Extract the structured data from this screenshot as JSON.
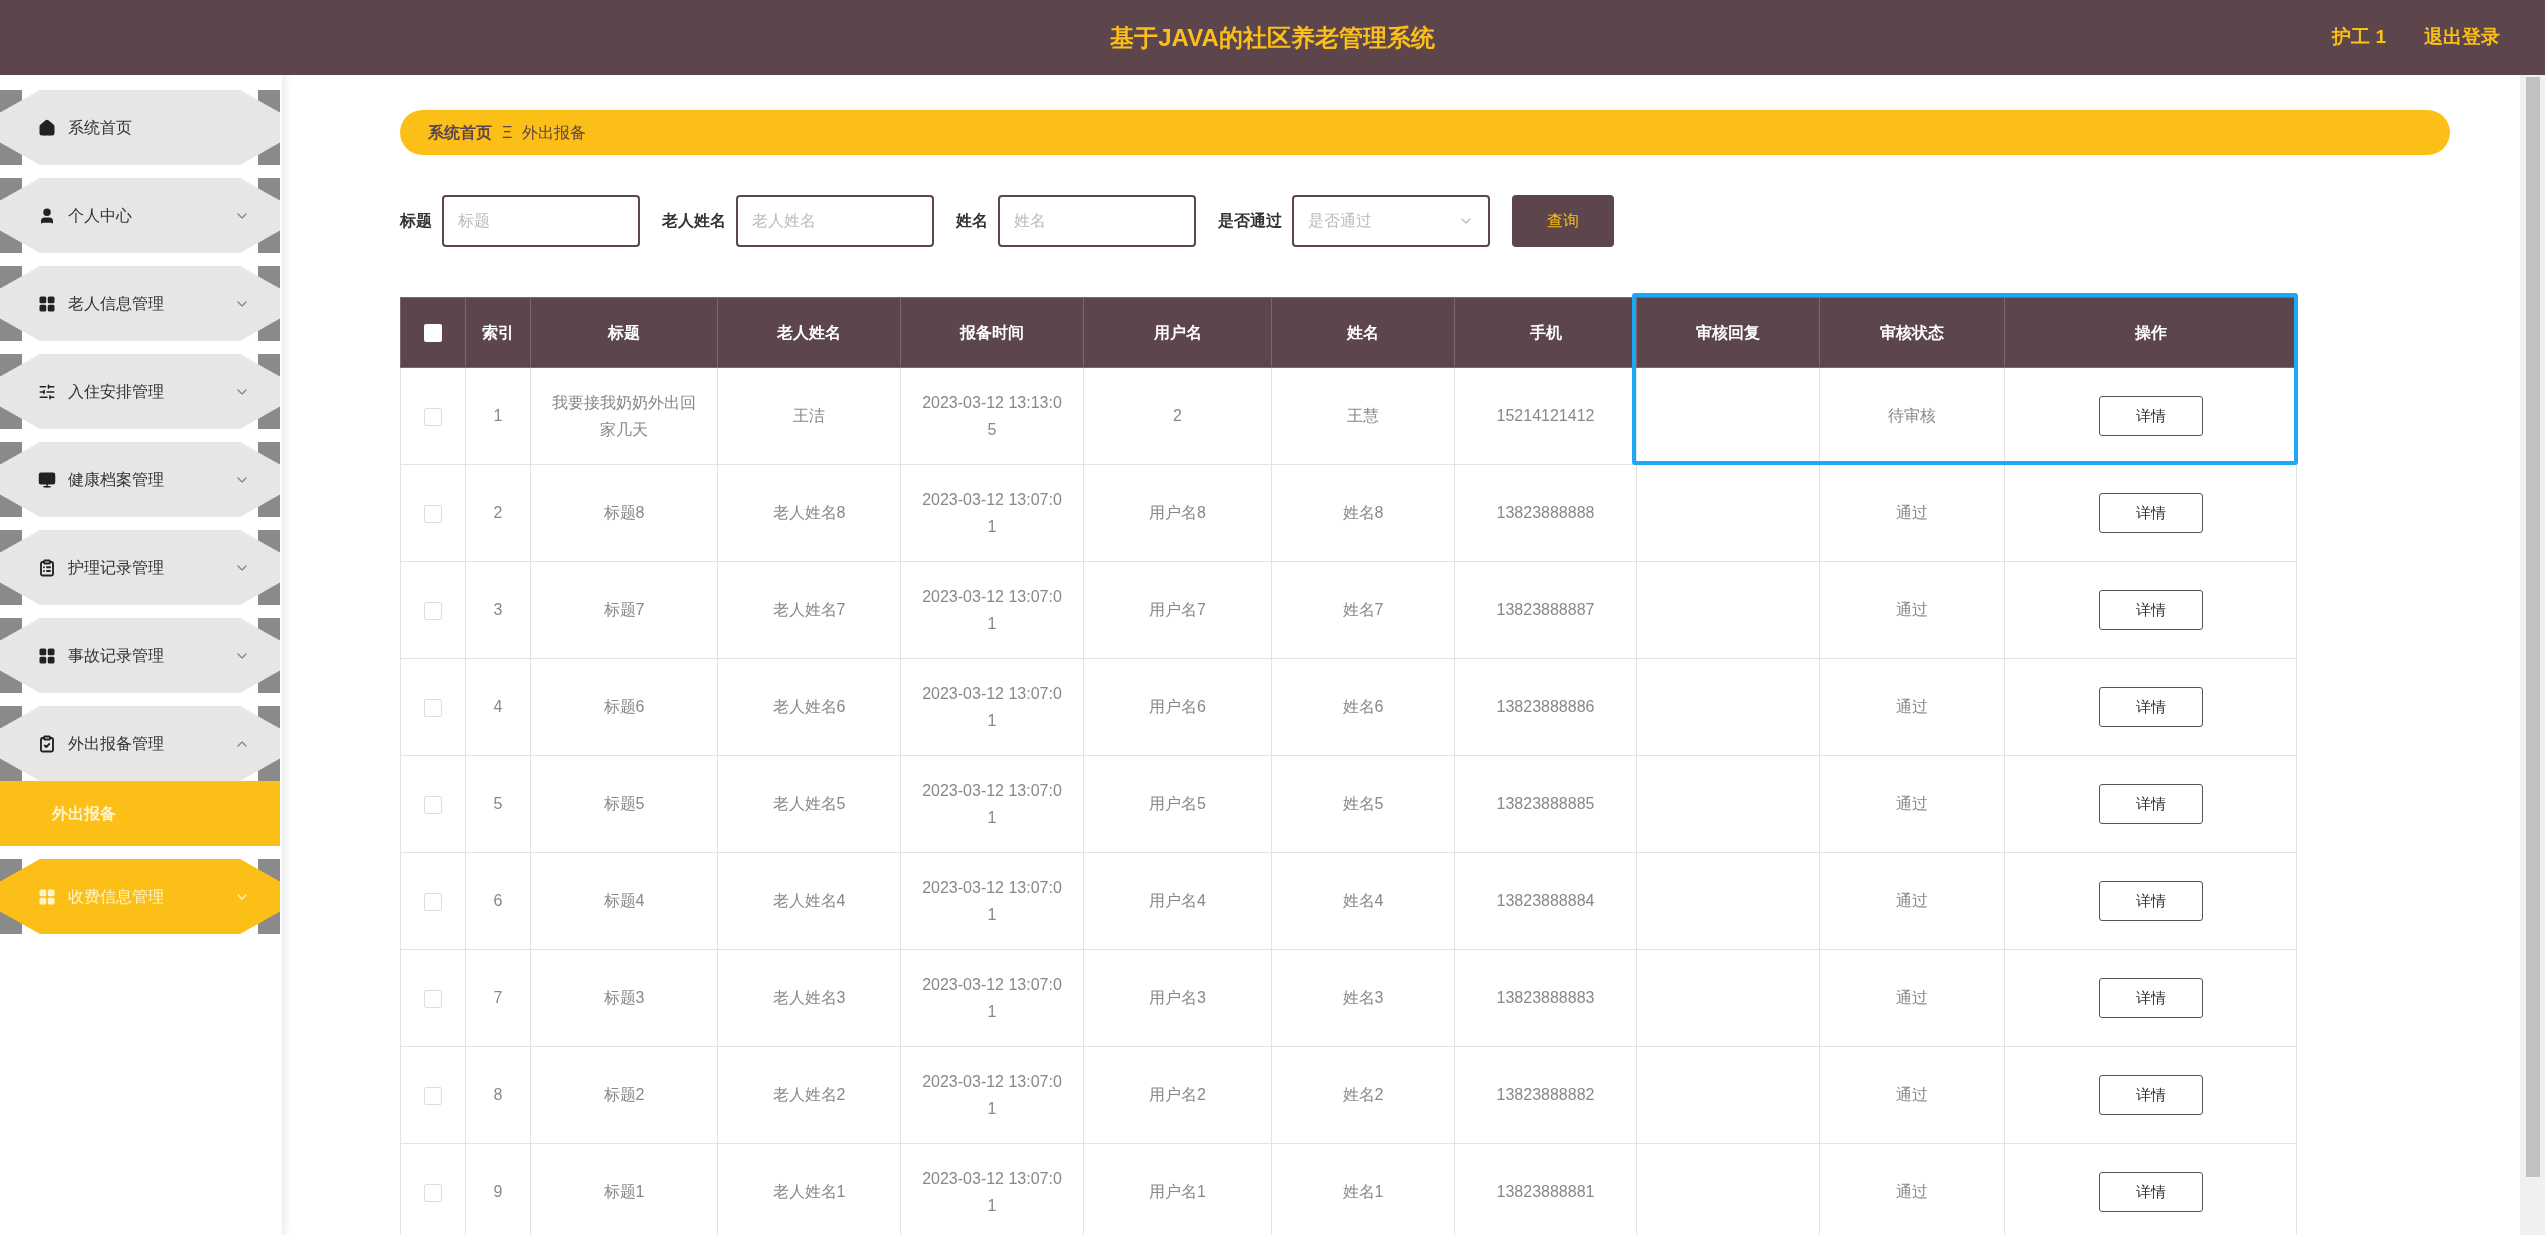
{
  "header": {
    "title": "基于JAVA的社区养老管理系统",
    "user": "护工 1",
    "logout": "退出登录"
  },
  "sidebar": {
    "items": [
      {
        "label": "系统首页",
        "selected": false
      },
      {
        "label": "个人中心",
        "selected": false,
        "expanded": false
      },
      {
        "label": "老人信息管理",
        "selected": false,
        "expanded": false
      },
      {
        "label": "入住安排管理",
        "selected": false,
        "expanded": false
      },
      {
        "label": "健康档案管理",
        "selected": false,
        "expanded": false
      },
      {
        "label": "护理记录管理",
        "selected": false,
        "expanded": false
      },
      {
        "label": "事故记录管理",
        "selected": false,
        "expanded": false
      },
      {
        "label": "外出报备管理",
        "selected": false,
        "expanded": true,
        "children": [
          {
            "label": "外出报备",
            "selected": true
          }
        ]
      },
      {
        "label": "收费信息管理",
        "selected": true,
        "expanded": false
      }
    ]
  },
  "breadcrumb": {
    "home": "系统首页",
    "separator": "Ξ",
    "current": "外出报备"
  },
  "search": {
    "fields": [
      {
        "kind": "input",
        "label": "标题",
        "placeholder": "标题"
      },
      {
        "kind": "input",
        "label": "老人姓名",
        "placeholder": "老人姓名"
      },
      {
        "kind": "input",
        "label": "姓名",
        "placeholder": "姓名"
      },
      {
        "kind": "select",
        "label": "是否通过",
        "placeholder": "是否通过"
      }
    ],
    "button": "查询"
  },
  "table": {
    "header_checkbox": {
      "checked": false
    },
    "columns": [
      "索引",
      "标题",
      "老人姓名",
      "报备时间",
      "用户名",
      "姓名",
      "手机",
      "审核回复",
      "审核状态",
      "操作"
    ],
    "rows": [
      {
        "checked": false,
        "index": "1",
        "title": "我要接我奶奶外出回家几天",
        "elder": "王洁",
        "time": "2023-03-12 13:13:05",
        "username": "2",
        "name": "王慧",
        "phone": "15214121412",
        "status": "待审核",
        "action": "详情"
      },
      {
        "checked": false,
        "index": "2",
        "title": "标题8",
        "elder": "老人姓名8",
        "time": "2023-03-12 13:07:01",
        "username": "用户名8",
        "name": "姓名8",
        "phone": "13823888888",
        "status": "通过",
        "action": "详情"
      },
      {
        "checked": false,
        "index": "3",
        "title": "标题7",
        "elder": "老人姓名7",
        "time": "2023-03-12 13:07:01",
        "username": "用户名7",
        "name": "姓名7",
        "phone": "13823888887",
        "status": "通过",
        "action": "详情"
      },
      {
        "checked": false,
        "index": "4",
        "title": "标题6",
        "elder": "老人姓名6",
        "time": "2023-03-12 13:07:01",
        "username": "用户名6",
        "name": "姓名6",
        "phone": "13823888886",
        "status": "通过",
        "action": "详情"
      },
      {
        "checked": false,
        "index": "5",
        "title": "标题5",
        "elder": "老人姓名5",
        "time": "2023-03-12 13:07:01",
        "username": "用户名5",
        "name": "姓名5",
        "phone": "13823888885",
        "status": "通过",
        "action": "详情"
      },
      {
        "checked": false,
        "index": "6",
        "title": "标题4",
        "elder": "老人姓名4",
        "time": "2023-03-12 13:07:01",
        "username": "用户名4",
        "name": "姓名4",
        "phone": "13823888884",
        "status": "通过",
        "action": "详情"
      },
      {
        "checked": false,
        "index": "7",
        "title": "标题3",
        "elder": "老人姓名3",
        "time": "2023-03-12 13:07:01",
        "username": "用户名3",
        "name": "姓名3",
        "phone": "13823888883",
        "status": "通过",
        "action": "详情"
      },
      {
        "checked": false,
        "index": "8",
        "title": "标题2",
        "elder": "老人姓名2",
        "time": "2023-03-12 13:07:01",
        "username": "用户名2",
        "name": "姓名2",
        "phone": "13823888882",
        "status": "通过",
        "action": "详情"
      },
      {
        "checked": false,
        "index": "9",
        "title": "标题1",
        "elder": "老人姓名1",
        "time": "2023-03-12 13:07:01",
        "username": "用户名1",
        "name": "姓名1",
        "phone": "13823888881",
        "status": "通过",
        "action": "详情"
      }
    ]
  }
}
